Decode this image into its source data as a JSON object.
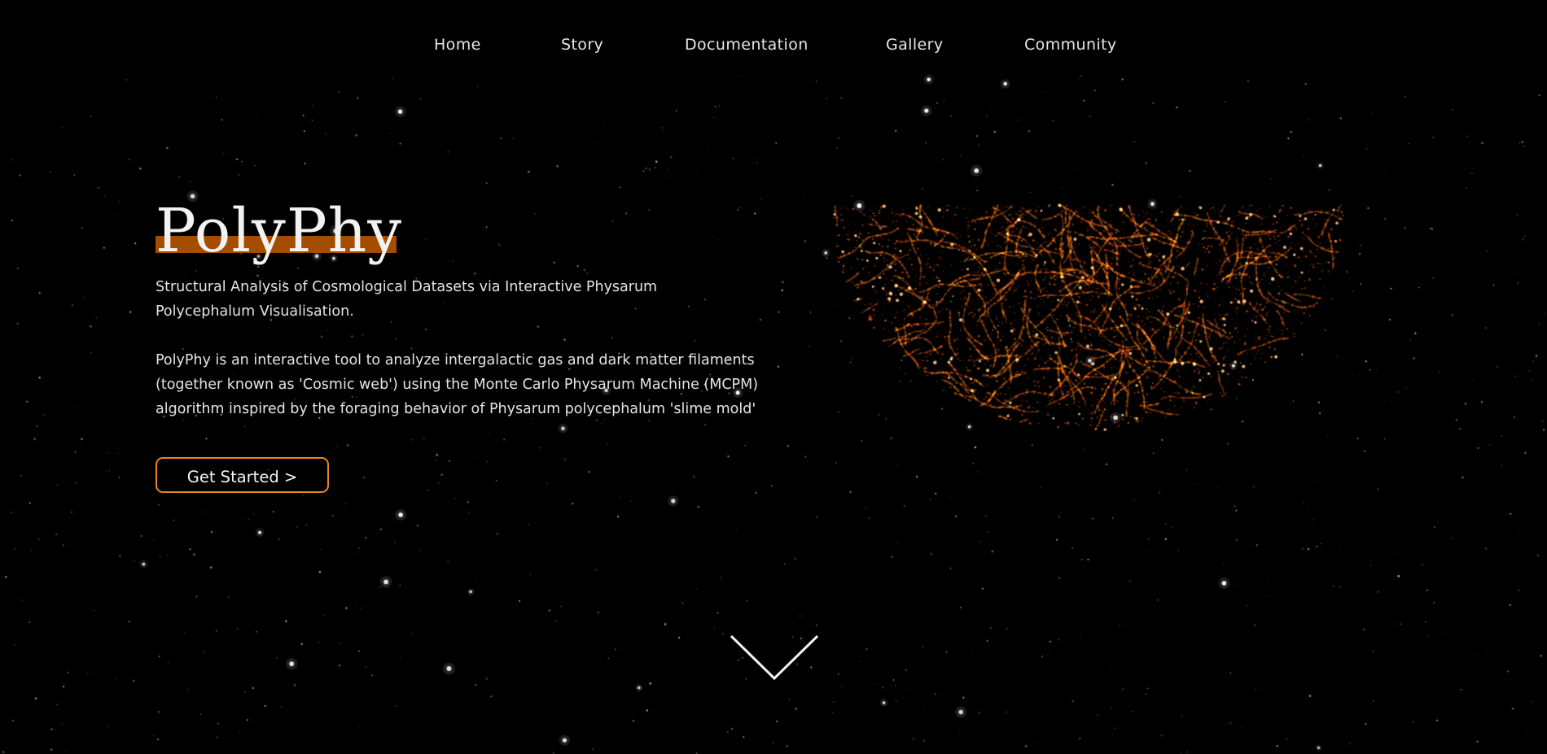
{
  "nav": {
    "items": [
      {
        "label": "Home"
      },
      {
        "label": "Story"
      },
      {
        "label": "Documentation"
      },
      {
        "label": "Gallery"
      },
      {
        "label": "Community"
      }
    ]
  },
  "hero": {
    "title": "PolyPhy",
    "subtitle": "Structural Analysis of Cosmological Datasets via Interactive Physarum Polycephalum Visualisation.",
    "description": "PolyPhy is an interactive tool to analyze intergalactic gas and dark matter filaments (together known as 'Cosmic web') using the Monte Carlo Physarum Machine (MCPM) algorithm inspired by the foraging behavior of Physarum polycephalum 'slime mold'",
    "cta_label": "Get Started >"
  },
  "colors": {
    "background": "#000000",
    "accent": "#e8871f",
    "title_highlight": "#a24d00",
    "filament": "#ff5a14"
  },
  "icons": {
    "scroll": "chevron-down-icon",
    "illustration": "cosmic-web-visualization"
  }
}
